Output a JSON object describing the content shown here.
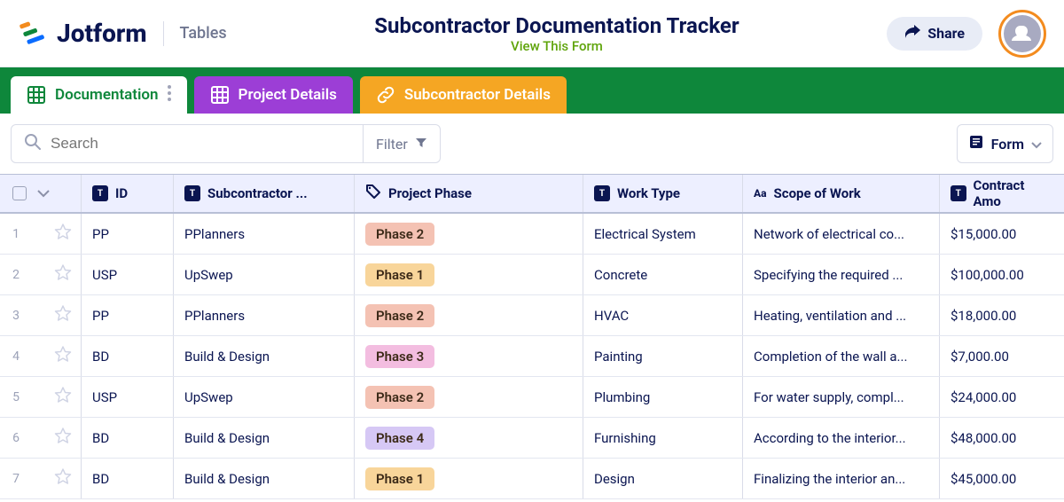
{
  "header": {
    "brand": "Jotform",
    "product": "Tables",
    "title": "Subcontractor Documentation Tracker",
    "view_form": "View This Form",
    "share": "Share"
  },
  "tabs": [
    {
      "label": "Documentation",
      "style": "active"
    },
    {
      "label": "Project Details",
      "style": "purple"
    },
    {
      "label": "Subcontractor Details",
      "style": "orange"
    }
  ],
  "toolbar": {
    "search_placeholder": "Search",
    "filter": "Filter",
    "form_button": "Form"
  },
  "columns": {
    "id": "ID",
    "subcontractor": "Subcontractor ...",
    "phase": "Project Phase",
    "work_type": "Work Type",
    "scope": "Scope of Work",
    "contract": "Contract Amo"
  },
  "phase_class": {
    "Phase 1": "tag-phase1",
    "Phase 2": "tag-phase2",
    "Phase 3": "tag-phase3",
    "Phase 4": "tag-phase4"
  },
  "rows": [
    {
      "n": "1",
      "id": "PP",
      "sub": "PPlanners",
      "phase": "Phase 2",
      "work": "Electrical System",
      "scope": "Network of electrical co...",
      "amt": "$15,000.00"
    },
    {
      "n": "2",
      "id": "USP",
      "sub": "UpSwep",
      "phase": "Phase 1",
      "work": "Concrete",
      "scope": "Specifying the required ...",
      "amt": "$100,000.00"
    },
    {
      "n": "3",
      "id": "PP",
      "sub": "PPlanners",
      "phase": "Phase 2",
      "work": "HVAC",
      "scope": "Heating, ventilation and ...",
      "amt": "$18,000.00"
    },
    {
      "n": "4",
      "id": "BD",
      "sub": "Build & Design",
      "phase": "Phase 3",
      "work": "Painting",
      "scope": "Completion of the wall a...",
      "amt": "$7,000.00"
    },
    {
      "n": "5",
      "id": "USP",
      "sub": "UpSwep",
      "phase": "Phase 2",
      "work": "Plumbing",
      "scope": "For water supply, compl...",
      "amt": "$24,000.00"
    },
    {
      "n": "6",
      "id": "BD",
      "sub": "Build & Design",
      "phase": "Phase 4",
      "work": "Furnishing",
      "scope": "According to the interior...",
      "amt": "$48,000.00"
    },
    {
      "n": "7",
      "id": "BD",
      "sub": "Build & Design",
      "phase": "Phase 1",
      "work": "Design",
      "scope": "Finalizing the interior an...",
      "amt": "$45,000.00"
    }
  ]
}
